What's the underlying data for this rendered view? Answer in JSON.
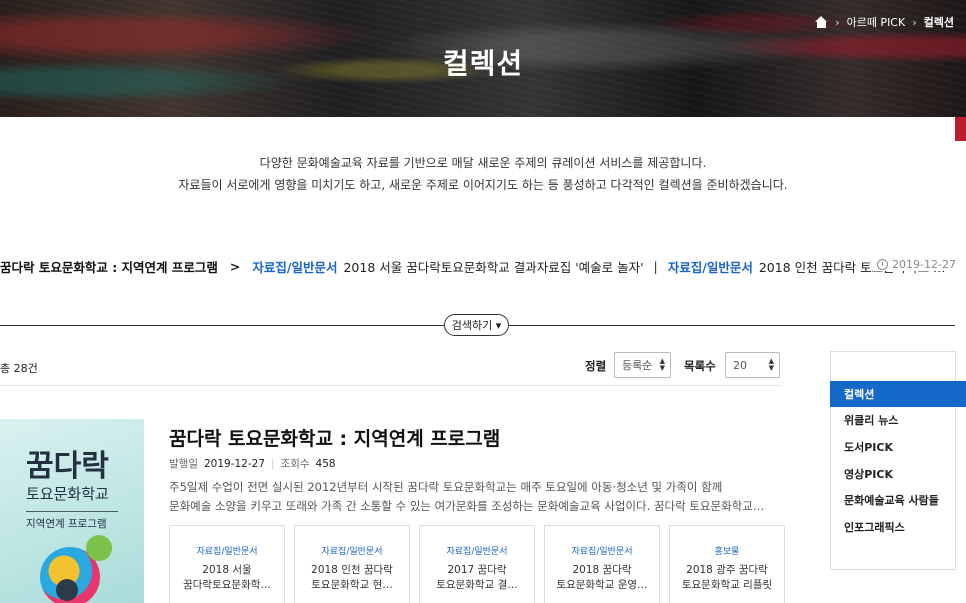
{
  "hero": {
    "title": "컬렉션",
    "breadcrumb": {
      "section": "아르떼 PICK",
      "current": "컬렉션"
    }
  },
  "intro": {
    "line1": "다양한 문화예술교육 자료를 기반으로 매달 새로운 주제의 큐레이션 서비스를 제공합니다.",
    "line2": "자료들이 서로에게 영향을 미치기도 하고, 새로운 주제로 이어지기도 하는 등 풍성하고 다각적인 컬렉션을 준비하겠습니다."
  },
  "ticker": {
    "title": "꿈다락 토요문화학교 : 지역연계 프로그램",
    "arrow": ">",
    "items": [
      {
        "category": "자료집/일반문서",
        "title": "2018 서울 꿈다락토요문화학교 결과자료집 '예술로 놀자'"
      },
      {
        "category": "자료집/일반문서",
        "title": "2018 인천 꿈다락 토요문화학교 …"
      }
    ],
    "separator": "|",
    "date": "2019-12-27"
  },
  "search": {
    "toggle_label": "검색하기 ▾"
  },
  "toolbar": {
    "total": "총 28건",
    "sort_label": "정렬",
    "sort_value": "등록순",
    "count_label": "목록수",
    "count_value": "20"
  },
  "featured": {
    "thumb": {
      "line1": "꿈다락",
      "line2": "토요문화학교",
      "line3": "지역연계 프로그램"
    },
    "title": "꿈다락 토요문화학교 : 지역연계 프로그램",
    "meta": {
      "date_label": "발행일",
      "date": "2019-12-27",
      "views_label": "조회수",
      "views": "458"
    },
    "desc1": "주5일제 수업이 전면 실시된 2012년부터 시작된 꿈다락 토요문화학교는 매주 토요일에 아동·청소년 및 가족이 함께",
    "desc2": "문화예술 소양을 키우고 또래와 가족 간 소통할 수 있는 여가문화를 조성하는 문화예술교육 사업이다. 꿈다락 토요문화학교…"
  },
  "cards": [
    {
      "category": "자료집/일반문서",
      "title1": "2018 서울",
      "title2": "꿈다락토요문화학…"
    },
    {
      "category": "자료집/일반문서",
      "title1": "2018 인천 꿈다락",
      "title2": "토요문화학교 현…"
    },
    {
      "category": "자료집/일반문서",
      "title1": "2017 꿈다락",
      "title2": "토요문화학교 결…"
    },
    {
      "category": "자료집/일반문서",
      "title1": "2018 꿈다락",
      "title2": "토요문화학교 운영…"
    },
    {
      "category": "홍보물",
      "title1": "2018 광주 꿈다락",
      "title2": "토요문화학교 리플릿"
    }
  ],
  "sidebar": {
    "items": [
      "컬렉션",
      "위클리 뉴스",
      "도서PICK",
      "영상PICK",
      "문화예술교육 사람들",
      "인포그래픽스"
    ]
  },
  "colors": {
    "accent": "#1468c8",
    "link": "#1a64c8",
    "brand_red": "#c11b2e"
  }
}
